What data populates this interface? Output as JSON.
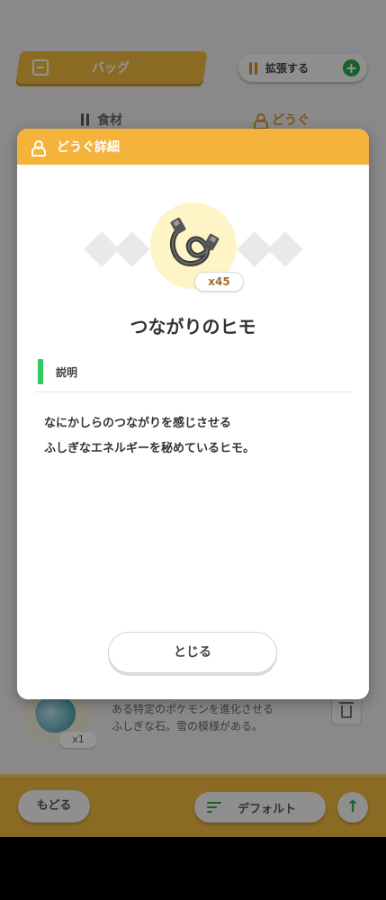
{
  "background": {
    "bag_title": "バッグ",
    "expand_label": "拡張する",
    "tabs": [
      {
        "label": "食材",
        "active": false
      },
      {
        "label": "どうぐ",
        "active": true
      }
    ],
    "item": {
      "quantity": "x1",
      "description_lines": [
        "ある特定のポケモンを進化させる",
        "ふしぎな石。雪の模様がある。"
      ]
    },
    "bottom": {
      "back_label": "もどる",
      "sort_label": "デフォルト"
    }
  },
  "modal": {
    "title": "どうぐ詳細",
    "item_name": "つながりのヒモ",
    "quantity": "x45",
    "section_label": "説明",
    "description_lines": [
      "なにかしらのつながりを感じさせる",
      "ふしぎなエネルギーを秘めているヒモ。"
    ],
    "close_label": "とじる"
  },
  "colors": {
    "accent": "#f4b43c",
    "green": "#2ea84b",
    "section_bar": "#2fcb62"
  },
  "icons": [
    "bag-icon",
    "fork-icon",
    "plus-icon",
    "person-icon",
    "trash-icon",
    "sort-icon",
    "arrow-up-icon",
    "cable-icon",
    "ice-stone-icon"
  ]
}
